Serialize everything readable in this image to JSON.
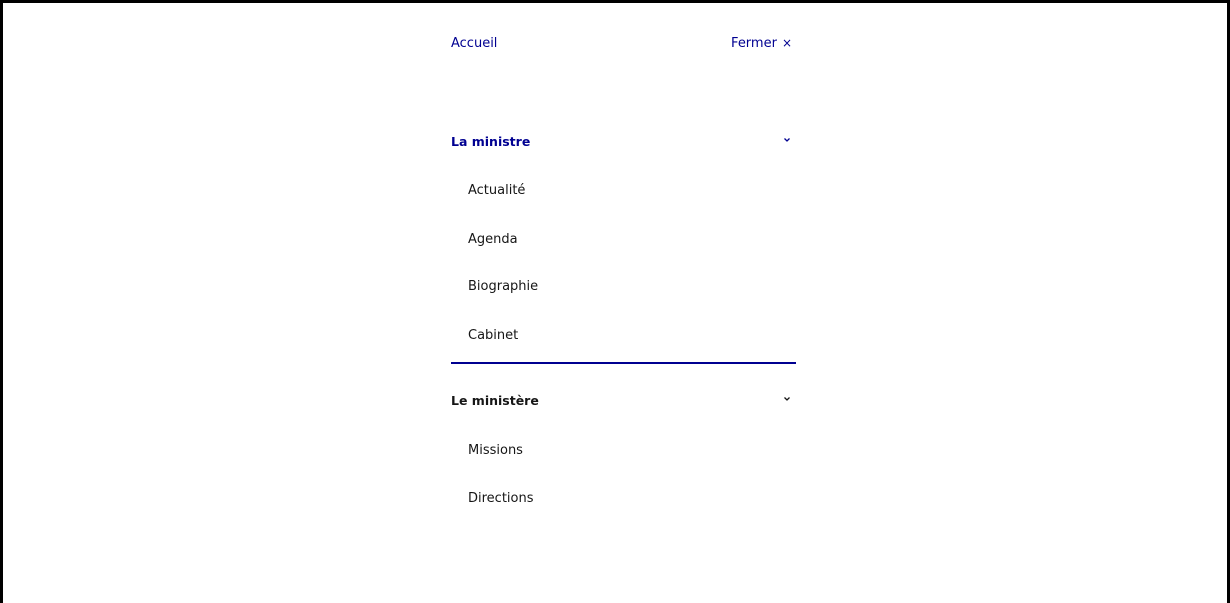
{
  "topbar": {
    "home_label": "Accueil",
    "close_label": "Fermer",
    "close_icon": "×"
  },
  "sections": [
    {
      "label": "La ministre",
      "expanded": true,
      "items": [
        "Actualité",
        "Agenda",
        "Biographie",
        "Cabinet"
      ]
    },
    {
      "label": "Le ministère",
      "expanded": true,
      "items": [
        "Missions",
        "Directions"
      ]
    }
  ],
  "colors": {
    "accent": "#000091",
    "text": "#161616"
  }
}
